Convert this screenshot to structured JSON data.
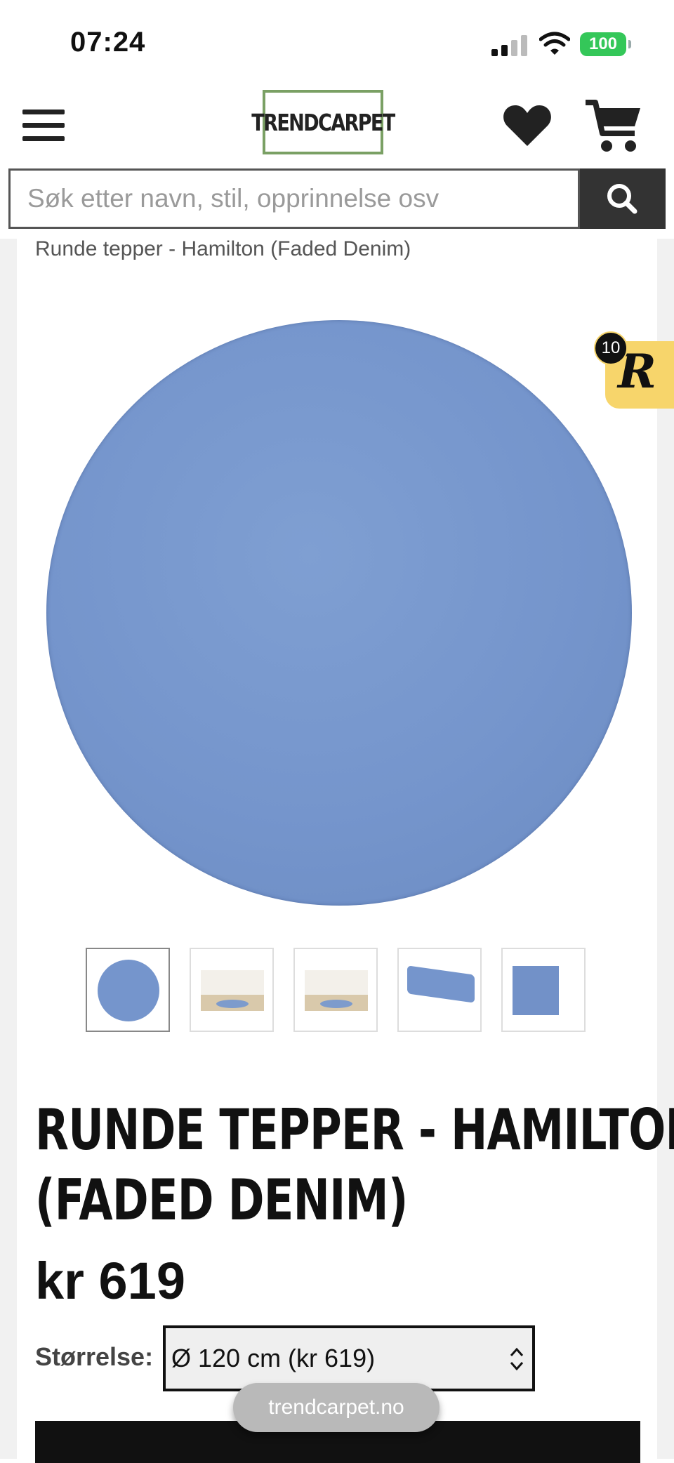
{
  "status_bar": {
    "time": "07:24",
    "battery": "100"
  },
  "header": {
    "logo_text": "TRENDCARPET"
  },
  "search": {
    "placeholder": "Søk etter navn, stil, opprinnelse osv"
  },
  "breadcrumb": "Runde tepper - Hamilton (Faded Denim)",
  "badge": {
    "count": "10",
    "letter": "R"
  },
  "product": {
    "title_line1": "RUNDE TEPPER - HAMILTON",
    "title_line2": "(FADED DENIM)",
    "price": "kr 619",
    "size_label": "Størrelse:",
    "size_selected": "Ø 120 cm (kr 619)",
    "image_color": "#7595cc"
  },
  "thumbnails": [
    "round-rug",
    "room-scene-1",
    "room-scene-2",
    "rolled-rug",
    "swatch"
  ],
  "browser": {
    "url": "trendcarpet.no"
  },
  "colors": {
    "brand_green": "#7aa064",
    "search_button": "#333333",
    "badge": "#f7d56b"
  }
}
